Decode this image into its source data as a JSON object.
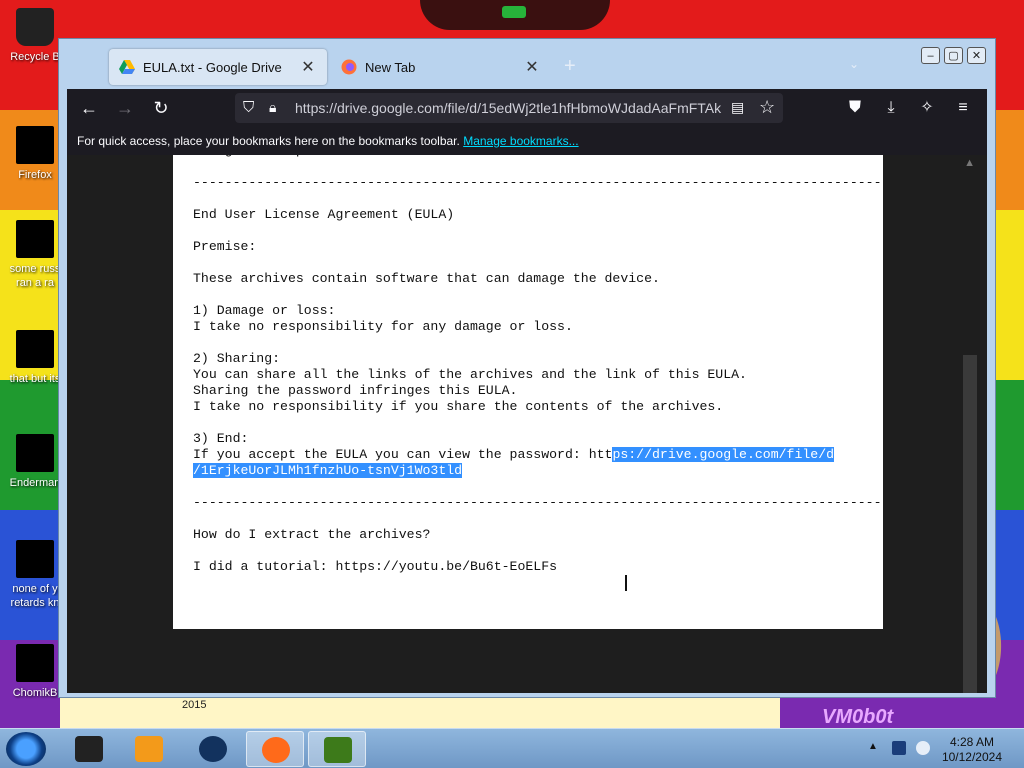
{
  "desktop": {
    "icons": [
      {
        "label": "Recycle B",
        "name": "recycle-bin-icon"
      },
      {
        "label": "Firefox",
        "name": "firefox-desktop-icon"
      },
      {
        "label": "some russ",
        "label2": "ran a ra",
        "name": "file-shortcut-icon"
      },
      {
        "label": "that but its",
        "name": "folder-shortcut-icon"
      },
      {
        "label": "Enderman",
        "name": "enderman-shortcut-icon"
      },
      {
        "label": "none of y",
        "label2": "retards kn",
        "name": "red-app-shortcut-icon"
      },
      {
        "label": "ChomikB",
        "name": "chomikbox-shortcut-icon"
      }
    ],
    "wallpaper_year": "2015",
    "wallpaper_watermark": "VM0b0t"
  },
  "browser": {
    "tabs": [
      {
        "title": "EULA.txt - Google Drive",
        "active": true,
        "icon": "google-drive-icon"
      },
      {
        "title": "New Tab",
        "active": false,
        "icon": "firefox-icon"
      }
    ],
    "new_tab_symbol": "+",
    "list_all_tabs_symbol": "⌄",
    "window_controls": {
      "minimize": "–",
      "maximize": "▢",
      "close": "✕"
    },
    "url": "https://drive.google.com/file/d/15edWj2tle1hfHbmoWJdadAaFmFTAk",
    "bookmarks_bar_text": "For quick access, place your bookmarks here on the bookmarks toolbar.",
    "bookmarks_bar_link": "Manage bookmarks..."
  },
  "document": {
    "lines_before_selection": "Telegram: https://t.me/tem...\n\n---------------------------------------------------------------------------------------------------------\n\nEnd User License Agreement (EULA)\n\nPremise:\n\nThese archives contain software that can damage the device.\n\n1) Damage or loss:\nI take no responsibility for any damage or loss.\n\n2) Sharing:\nYou can share all the links of the archives and the link of this EULA.\nSharing the password infringes this EULA.\nI take no responsibility if you share the contents of the archives.\n\n3) End:\nIf you accept the EULA you can view the password: htt",
    "selected_text": "ps://drive.google.com/file/d\n/1ErjkeUorJLMh1fnzhUo-tsnVj1Wo3tld",
    "lines_after_selection": "\n\n---------------------------------------------------------------------------------------------------------\n\nHow do I extract the archives?\n\nI did a tutorial: https://youtu.be/Bu6t-EoELFs"
  },
  "taskbar": {
    "items": [
      {
        "name": "virtualbox-taskbar-icon",
        "color": "#222222"
      },
      {
        "name": "media-player-taskbar-icon",
        "color": "#f39a1a"
      },
      {
        "name": "globe-taskbar-icon",
        "color": "#12325e"
      },
      {
        "name": "firefox-taskbar-icon",
        "color": "#ff6a1a"
      },
      {
        "name": "chomikbox-taskbar-icon",
        "color": "#3d7a1a"
      }
    ],
    "clock_time": "4:28 AM",
    "clock_date": "10/12/2024"
  }
}
